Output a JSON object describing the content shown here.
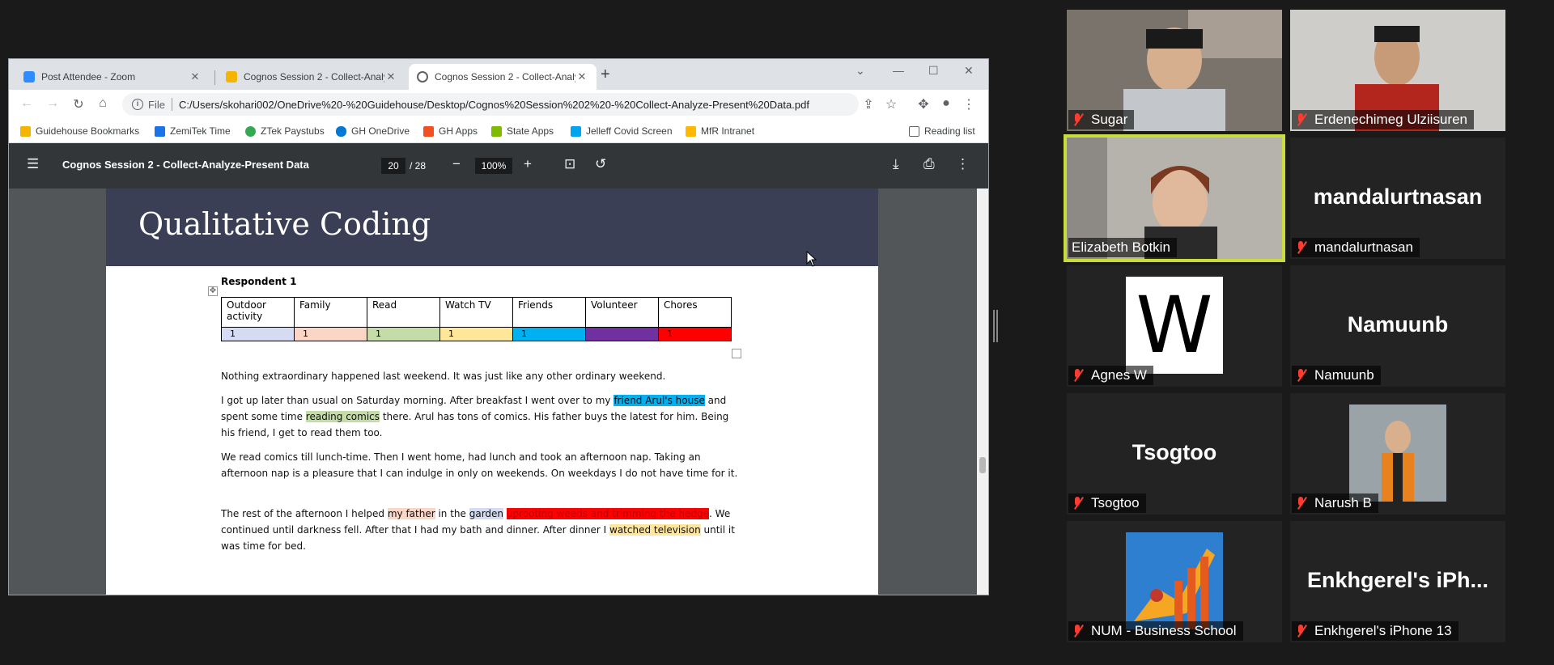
{
  "browser": {
    "tabs": [
      {
        "title": "Post Attendee - Zoom",
        "color": "#2d8cff"
      },
      {
        "title": "Cognos Session 2 - Collect-Analy",
        "color": "#f4b400"
      },
      {
        "title": "Cognos Session 2 - Collect-Analy",
        "color": "#5f6368"
      }
    ],
    "new_tab": "+",
    "address": {
      "scheme": "File",
      "url": "C:/Users/skohari002/OneDrive%20-%20Guidehouse/Desktop/Cognos%20Session%202%20-%20Collect-Analyze-Present%20Data.pdf"
    },
    "bookmarks": [
      {
        "label": "Guidehouse Bookmarks",
        "color": "#f4b400"
      },
      {
        "label": "ZemiTek Time",
        "color": "#1a73e8"
      },
      {
        "label": "ZTek Paystubs",
        "color": "#34a853"
      },
      {
        "label": "GH OneDrive",
        "color": "#0078d4"
      },
      {
        "label": "GH Apps",
        "color": "#f25022"
      },
      {
        "label": "State Apps",
        "color": "#7fba00"
      },
      {
        "label": "Jelleff Covid Screen",
        "color": "#00a4ef"
      },
      {
        "label": "MfR Intranet",
        "color": "#ffb900"
      },
      {
        "label": "Reading list",
        "color": "#5f6368"
      }
    ]
  },
  "pdf": {
    "title": "Cognos Session 2 - Collect-Analyze-Present Data",
    "page_current": "20",
    "page_total": "/ 28",
    "zoom": "100%"
  },
  "slide": {
    "title": "Qualitative Coding",
    "respondent": "Respondent 1",
    "table_headers": [
      "Outdoor activity",
      "Family",
      "Read",
      "Watch TV",
      "Friends",
      "Volunteer",
      "Chores"
    ],
    "table_values": [
      "1",
      "1",
      "1",
      "1",
      "1",
      "",
      "1"
    ],
    "table_colors": [
      "#d4dbf2",
      "#fbd5c6",
      "#c4dca8",
      "#ffe699",
      "#00b0f0",
      "#7030a0",
      "#ff0000"
    ],
    "p1": "Nothing extraordinary happened last weekend.  It was just like any other ordinary weekend.",
    "p2": {
      "a": "I got up later than usual on Saturday morning.  After breakfast I went over to my ",
      "b": "friend Arul's house",
      "c": " and spent some time ",
      "d": "reading comics",
      "e": " there.  Arul has tons of comics.   His father buys the latest for him.  Being his friend, I get to read them too."
    },
    "p3": "We read comics till lunch-time. Then I went home, had lunch and took an afternoon nap.   Taking an afternoon nap is a pleasure that I can indulge in only on weekends.  On weekdays I do not have time for it.",
    "p4": {
      "a": "The rest of the afternoon I helped ",
      "b": "my father",
      "c": " in the ",
      "d": "garden",
      "e": " ",
      "f": "uprooting weeds and trimming the hedge",
      "g": ".  We continued until darkness fell.  After that I had my bath and dinner.  After dinner I ",
      "h": "watched television",
      "i": " until it was time for bed."
    }
  },
  "participants": [
    {
      "name": "Sugar",
      "type": "video",
      "bg": "#6b6560"
    },
    {
      "name": "Erdenechimeg Ulziisuren",
      "type": "video",
      "bg": "#c9c6c2"
    },
    {
      "name": "Elizabeth Botkin",
      "type": "video",
      "bg": "#8a8782",
      "active": true
    },
    {
      "name": "mandalurtnasan",
      "type": "text",
      "big": "mandalurtnasan"
    },
    {
      "name": "Agnes W",
      "type": "avatar",
      "letter": "W"
    },
    {
      "name": "Namuunb",
      "type": "text",
      "big": "Namuunb"
    },
    {
      "name": "Tsogtoo",
      "type": "text",
      "big": "Tsogtoo"
    },
    {
      "name": "Narush B",
      "type": "photo"
    },
    {
      "name": "NUM - Business School",
      "type": "logo"
    },
    {
      "name": "Enkhgerel's iPhone 13",
      "type": "text",
      "big": "Enkhgerel's iPh..."
    }
  ]
}
